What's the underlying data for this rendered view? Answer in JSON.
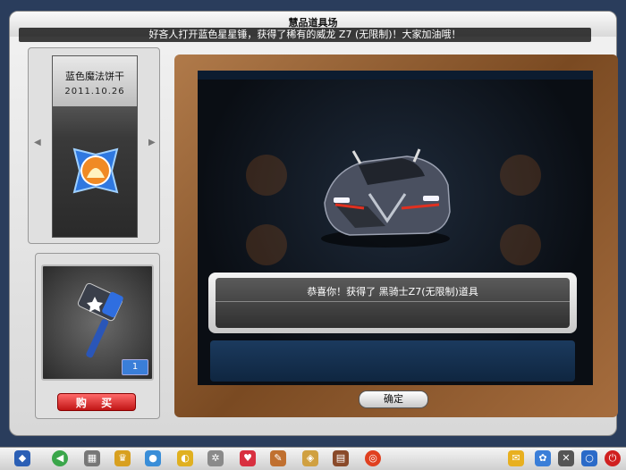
{
  "window": {
    "title": "慧品道具场",
    "ticker": "好吝人打开蓝色星星锤，获得了稀有的威龙 Z7 (无限制)！大家加油哦！"
  },
  "item_card": {
    "name": "蓝色魔法饼干",
    "date": "2011.10.26",
    "prev_arrow": "◀",
    "next_arrow": "▶"
  },
  "purchase": {
    "quantity": "1",
    "buy_label": "购 买"
  },
  "reward_dialog": {
    "message": "恭喜你！获得了 黑骑士Z7(无限制)道具",
    "ok_label": "确定"
  },
  "colors": {
    "accent_blue": "#3a7ed8",
    "buy_red": "#d42020",
    "frame_wood": "#8a5a30"
  },
  "taskbar_icons": [
    "start-icon",
    "back-icon",
    "shop-icon",
    "trophy-icon",
    "bag-icon",
    "car-icon",
    "settings-icon",
    "heart-icon",
    "pen-icon",
    "tag-icon",
    "book-icon",
    "target-icon",
    "note-icon",
    "pet-icon",
    "tools-icon",
    "search-icon",
    "power-icon"
  ]
}
